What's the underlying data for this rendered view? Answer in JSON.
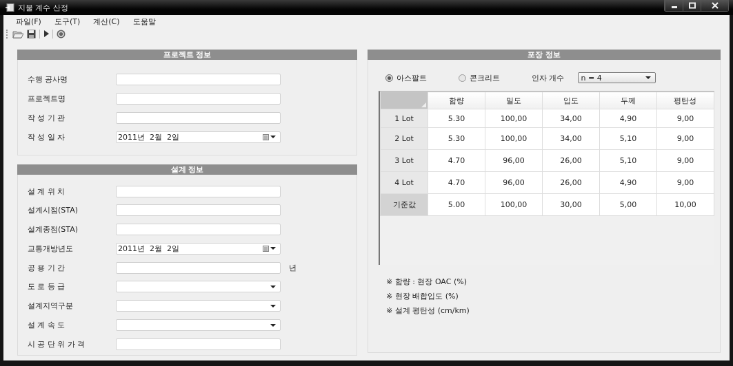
{
  "window": {
    "title": "지불 계수 산정"
  },
  "menu": [
    "파일(F)",
    "도구(T)",
    "계산(C)",
    "도움말"
  ],
  "project_info": {
    "title": "프로젝트 정보",
    "fields": [
      {
        "label": "수행 공사명",
        "kind": "text"
      },
      {
        "label": "프로젝트명",
        "kind": "text"
      },
      {
        "label": "작 성 기 관",
        "kind": "text"
      },
      {
        "label": "작 성 일 자",
        "kind": "date",
        "value": "2011년  2월  2일"
      }
    ]
  },
  "design_info": {
    "title": "설계 정보",
    "fields": [
      {
        "label": "설 계 위 치",
        "kind": "text"
      },
      {
        "label": "설계시점(STA)",
        "kind": "text"
      },
      {
        "label": "설계종점(STA)",
        "kind": "text"
      },
      {
        "label": "교통개방년도",
        "kind": "date",
        "value": "2011년  2월  2일"
      },
      {
        "label": "공 용 기 간",
        "kind": "text",
        "unit": "년"
      },
      {
        "label": "도 로 등 급",
        "kind": "select"
      },
      {
        "label": "설계지역구분",
        "kind": "select"
      },
      {
        "label": "설 계 속 도",
        "kind": "select"
      },
      {
        "label": "시 공 단 위 가 격",
        "kind": "text"
      }
    ]
  },
  "pavement_info": {
    "title": "포장 정보",
    "surface_options": [
      {
        "label": "아스팔트",
        "selected": true
      },
      {
        "label": "콘크리트",
        "selected": false
      }
    ],
    "factor_count": {
      "label": "인자 개수",
      "value": "n = 4"
    },
    "table": {
      "columns": [
        "함량",
        "밀도",
        "입도",
        "두께",
        "평탄성"
      ],
      "rows": [
        {
          "header": "1 Lot",
          "kind": "lot",
          "cells": [
            "5.30",
            "100,00",
            "34,00",
            "4,90",
            "9,00"
          ]
        },
        {
          "header": "2 Lot",
          "kind": "lot",
          "cells": [
            "5.30",
            "100,00",
            "34,00",
            "5,10",
            "9,00"
          ]
        },
        {
          "header": "3 Lot",
          "kind": "lot",
          "cells": [
            "4.70",
            "96,00",
            "26,00",
            "5,10",
            "9,00"
          ]
        },
        {
          "header": "4 Lot",
          "kind": "lot",
          "cells": [
            "4.70",
            "96,00",
            "26,00",
            "4,90",
            "9,00"
          ]
        },
        {
          "header": "기준값",
          "kind": "reference",
          "cells": [
            "5.00",
            "100,00",
            "30,00",
            "5,00",
            "10,00"
          ]
        }
      ]
    },
    "notes": [
      "※ 함량 : 현장 OAC (%)",
      "※ 현장 배합입도 (%)",
      "※ 설계 평탄성 (cm/km)"
    ]
  }
}
